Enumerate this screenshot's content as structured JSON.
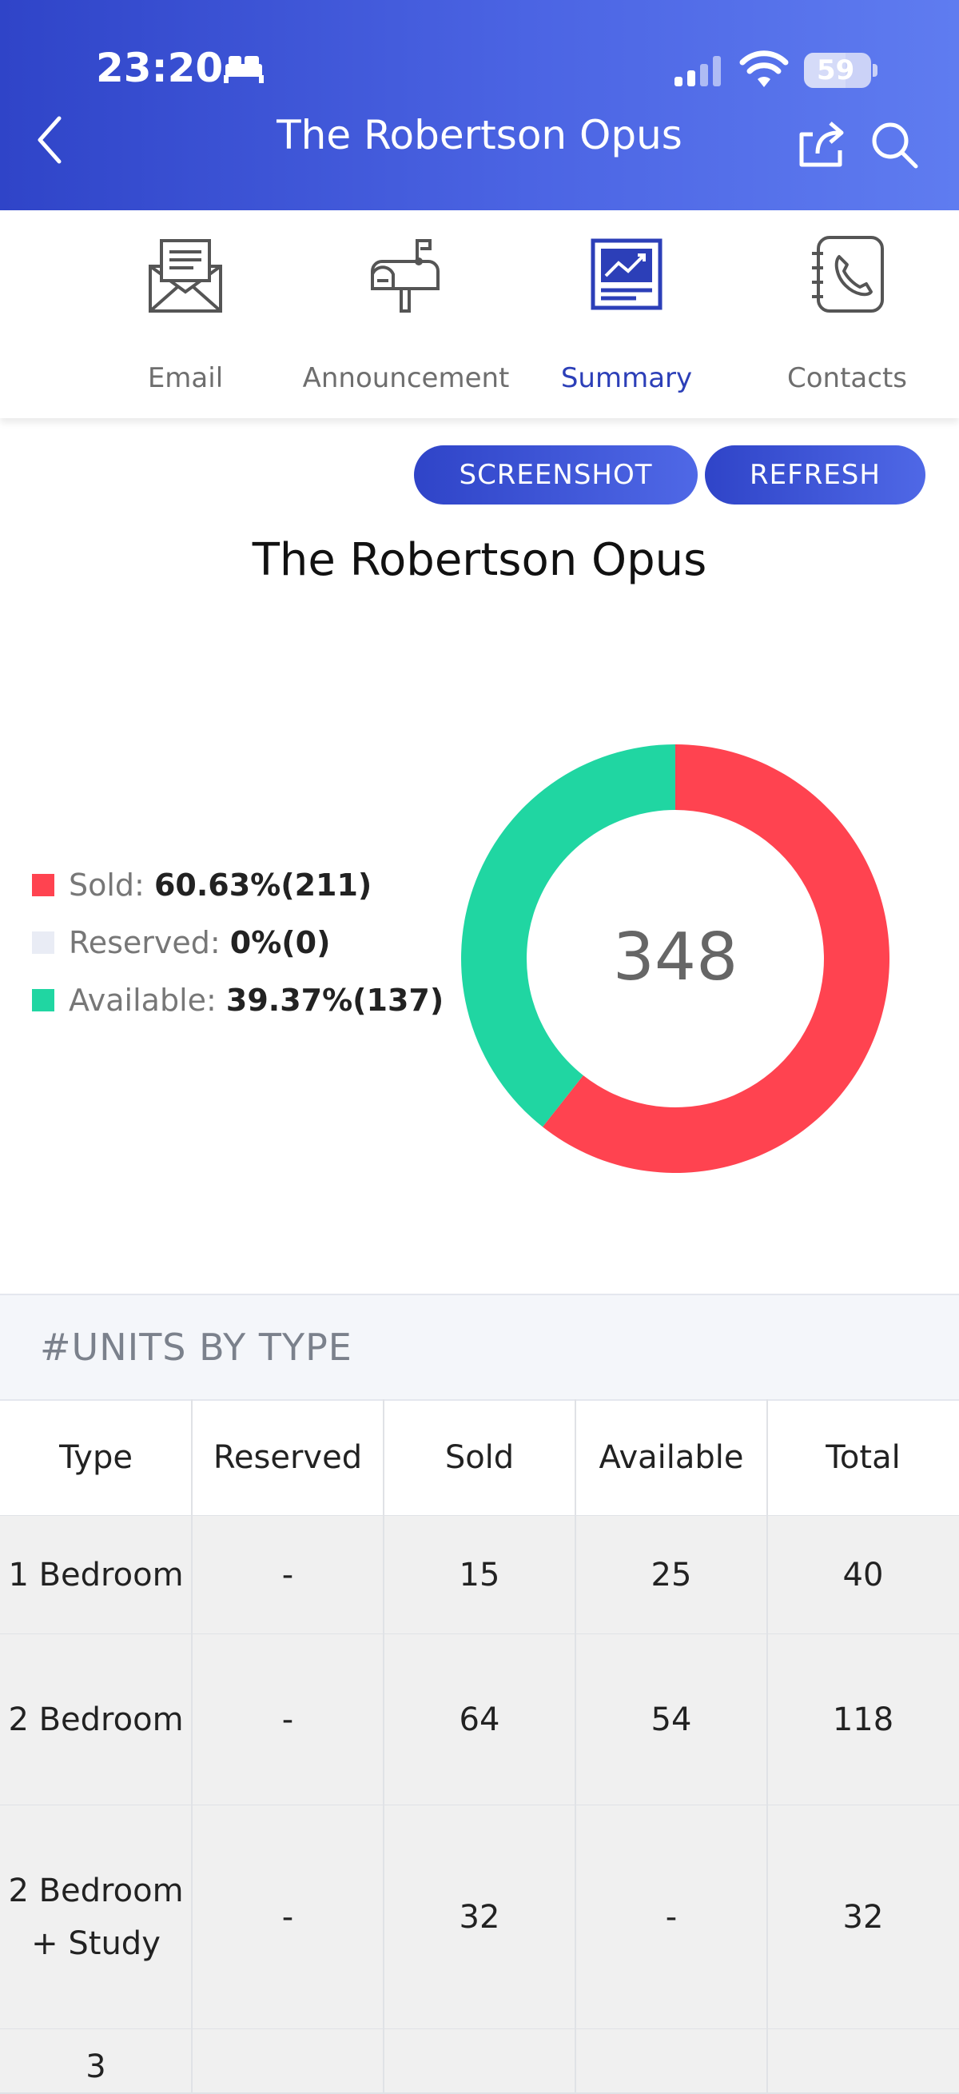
{
  "status_bar": {
    "time": "23:20",
    "battery": "59"
  },
  "header": {
    "title": "The Robertson Opus"
  },
  "tabs": [
    {
      "label": "Email",
      "icon": "envelope-icon"
    },
    {
      "label": "Announcement",
      "icon": "mailbox-icon"
    },
    {
      "label": "Summary",
      "icon": "chart-report-icon",
      "active": true
    },
    {
      "label": "Contacts",
      "icon": "phone-book-icon"
    }
  ],
  "buttons": {
    "screenshot": "SCREENSHOT",
    "refresh": "REFRESH"
  },
  "chart_title": "The Robertson Opus",
  "legend": [
    {
      "name": "Sold:",
      "value": "60.63%(211)",
      "color": "#ff4350"
    },
    {
      "name": "Reserved:",
      "value": "0%(0)",
      "color": "#e9ecf5"
    },
    {
      "name": "Available:",
      "value": "39.37%(137)",
      "color": "#20d6a2"
    }
  ],
  "chart_data": {
    "type": "pie",
    "center_label": "348",
    "series": [
      {
        "name": "Sold",
        "value": 211,
        "color": "#ff4350"
      },
      {
        "name": "Reserved",
        "value": 0,
        "color": "#e9ecf5"
      },
      {
        "name": "Available",
        "value": 137,
        "color": "#20d6a2"
      }
    ]
  },
  "table": {
    "section_title": "#UNITS BY TYPE",
    "headers": [
      "Type",
      "Reserved",
      "Sold",
      "Available",
      "Total"
    ],
    "rows": [
      [
        "1 Bedroom",
        "-",
        "15",
        "25",
        "40"
      ],
      [
        "2 Bedroom",
        "-",
        "64",
        "54",
        "118"
      ],
      [
        "2 Bedroom + Study",
        "-",
        "32",
        "-",
        "32"
      ],
      [
        "3",
        "",
        "",
        "",
        ""
      ]
    ]
  }
}
